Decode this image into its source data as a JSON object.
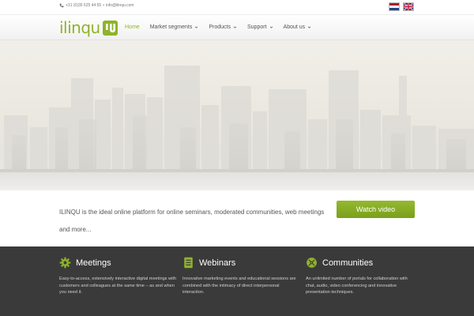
{
  "topbar": {
    "phone": "+31 (0)35 625 44 55",
    "separator": "•",
    "email": "info@ilinqu.com",
    "flags": [
      "nl-flag",
      "uk-flag"
    ]
  },
  "header": {
    "logo_text": "ilinqu",
    "nav": [
      {
        "label": "Home",
        "active": true
      },
      {
        "label": "Market segments",
        "dropdown": true
      },
      {
        "label": "Products",
        "dropdown": true
      },
      {
        "label": "Support",
        "dropdown": true
      },
      {
        "label": "About us",
        "dropdown": true
      }
    ]
  },
  "intro": {
    "text": "ILINQU is the ideal online platform for online seminars, moderated communities, web meetings and more...",
    "button_label": "Watch video"
  },
  "features": [
    {
      "icon": "gear-icon",
      "title": "Meetings",
      "desc": "Easy-to-access, extensively interactive digital meetings with customers and colleagues at the same time – as and when you need it."
    },
    {
      "icon": "document-icon",
      "title": "Webinars",
      "desc": "Innovative marketing events and educational sessions are combined with the intimacy of direct interpersonal interaction."
    },
    {
      "icon": "globe-icon",
      "title": "Communities",
      "desc": "An unlimited number of portals for collaboration with chat, audio, video conferencing and innovative presentation techniques."
    }
  ],
  "colors": {
    "brand_green": "#8fb32a",
    "footer_bg": "#3a3a3a"
  }
}
